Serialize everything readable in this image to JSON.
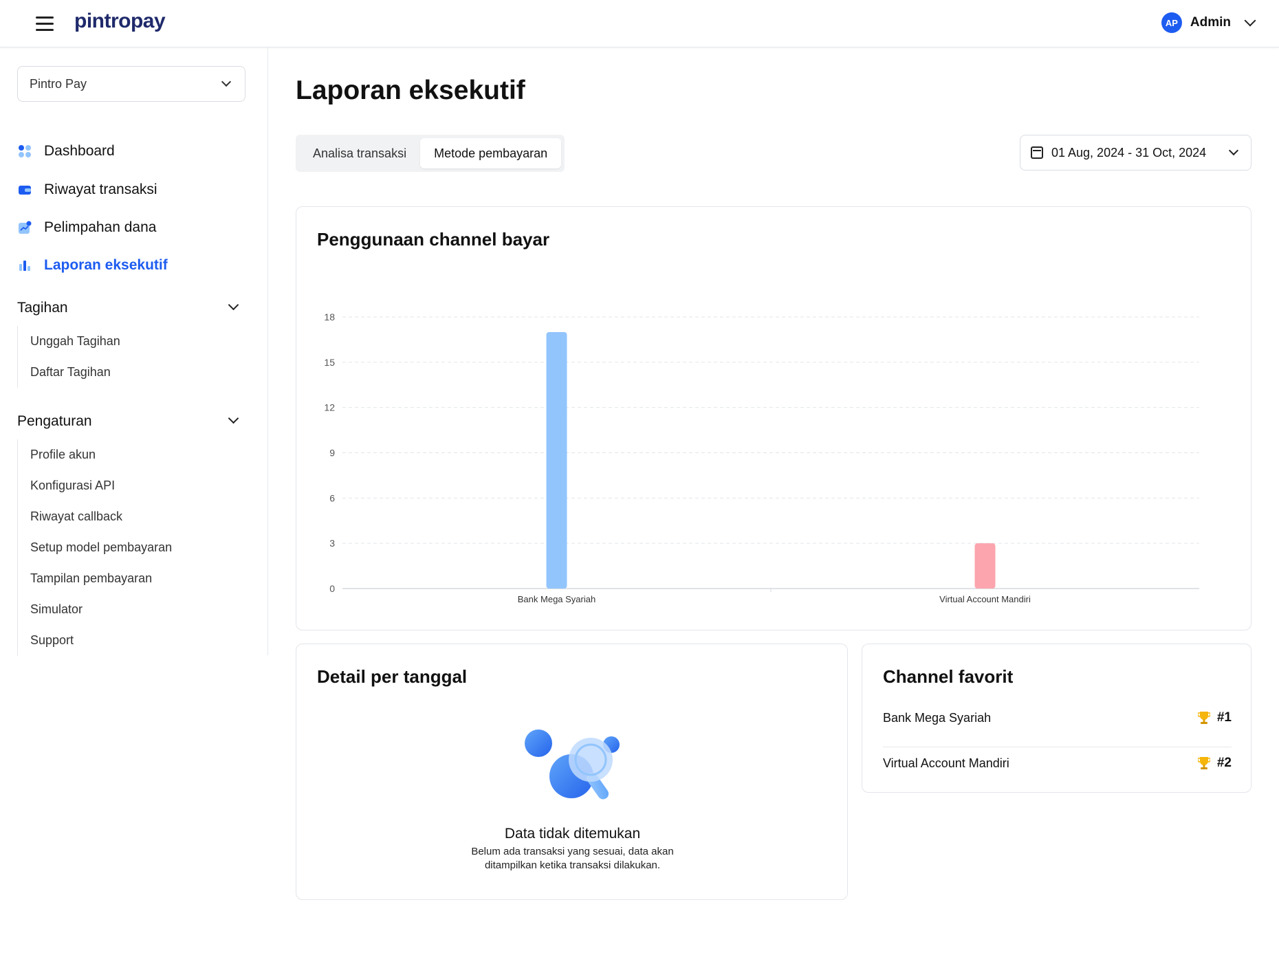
{
  "app": {
    "logo_text": "pintropay",
    "user": {
      "initials": "AP",
      "name": "Admin"
    }
  },
  "sidebar": {
    "org_select": "Pintro Pay",
    "nav": [
      {
        "label": "Dashboard",
        "icon": "dashboard-grid-icon"
      },
      {
        "label": "Riwayat transaksi",
        "icon": "wallet-icon"
      },
      {
        "label": "Pelimpahan dana",
        "icon": "transfer-icon"
      },
      {
        "label": "Laporan eksekutif",
        "icon": "bar-chart-icon",
        "active": true
      }
    ],
    "tagihan": {
      "label": "Tagihan",
      "items": [
        "Unggah Tagihan",
        "Daftar Tagihan"
      ]
    },
    "pengaturan": {
      "label": "Pengaturan",
      "items": [
        "Profile akun",
        "Konfigurasi API",
        "Riwayat callback",
        "Setup model pembayaran",
        "Tampilan pembayaran",
        "Simulator",
        "Support"
      ]
    }
  },
  "main": {
    "title": "Laporan eksekutif",
    "tabs": [
      {
        "label": "Analisa transaksi",
        "active": false
      },
      {
        "label": "Metode pembayaran",
        "active": true
      }
    ],
    "date_range": "01 Aug, 2024 - 31 Oct, 2024",
    "chart_card_title": "Penggunaan channel bayar",
    "detail_card": {
      "title": "Detail per tanggal",
      "empty_title": "Data tidak ditemukan",
      "empty_desc": "Belum ada transaksi yang sesuai, data akan ditampilkan ketika transaksi dilakukan."
    },
    "favorite_card": {
      "title": "Channel favorit",
      "items": [
        {
          "name": "Bank Mega Syariah",
          "rank": "#1"
        },
        {
          "name": "Virtual Account Mandiri",
          "rank": "#2"
        }
      ]
    }
  },
  "colors": {
    "accent": "#1d5cf0",
    "bar_blue": "#93c5fd",
    "bar_pink": "#fca5ae"
  },
  "chart_data": {
    "type": "bar",
    "categories": [
      "Bank Mega Syariah",
      "Virtual Account Mandiri"
    ],
    "values": [
      17,
      3
    ],
    "colors": [
      "#93c5fd",
      "#fca5ae"
    ],
    "ylim": [
      0,
      18
    ],
    "yticks": [
      0,
      3,
      6,
      9,
      12,
      15,
      18
    ],
    "grid": true
  }
}
